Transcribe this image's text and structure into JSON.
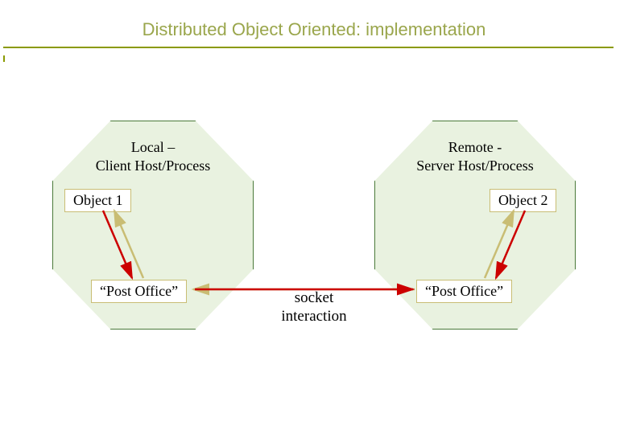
{
  "title": "Distributed Object Oriented: implementation",
  "left": {
    "host_line1": "Local –",
    "host_line2": "Client Host/Process",
    "object_label": "Object 1",
    "post_office_label": "“Post Office”"
  },
  "right": {
    "host_line1": "Remote -",
    "host_line2": "Server Host/Process",
    "object_label": "Object 2",
    "post_office_label": "“Post Office”"
  },
  "center": {
    "socket_line1": "socket",
    "socket_line2": "interaction"
  },
  "colors": {
    "title": "#9aa64c",
    "rule": "#8a9a00",
    "octagon_fill": "#e9f2e0",
    "octagon_stroke": "#4a7a3a",
    "box_border": "#c9bd74",
    "arrow_red": "#cc0000",
    "arrow_tan": "#c9bd74"
  }
}
